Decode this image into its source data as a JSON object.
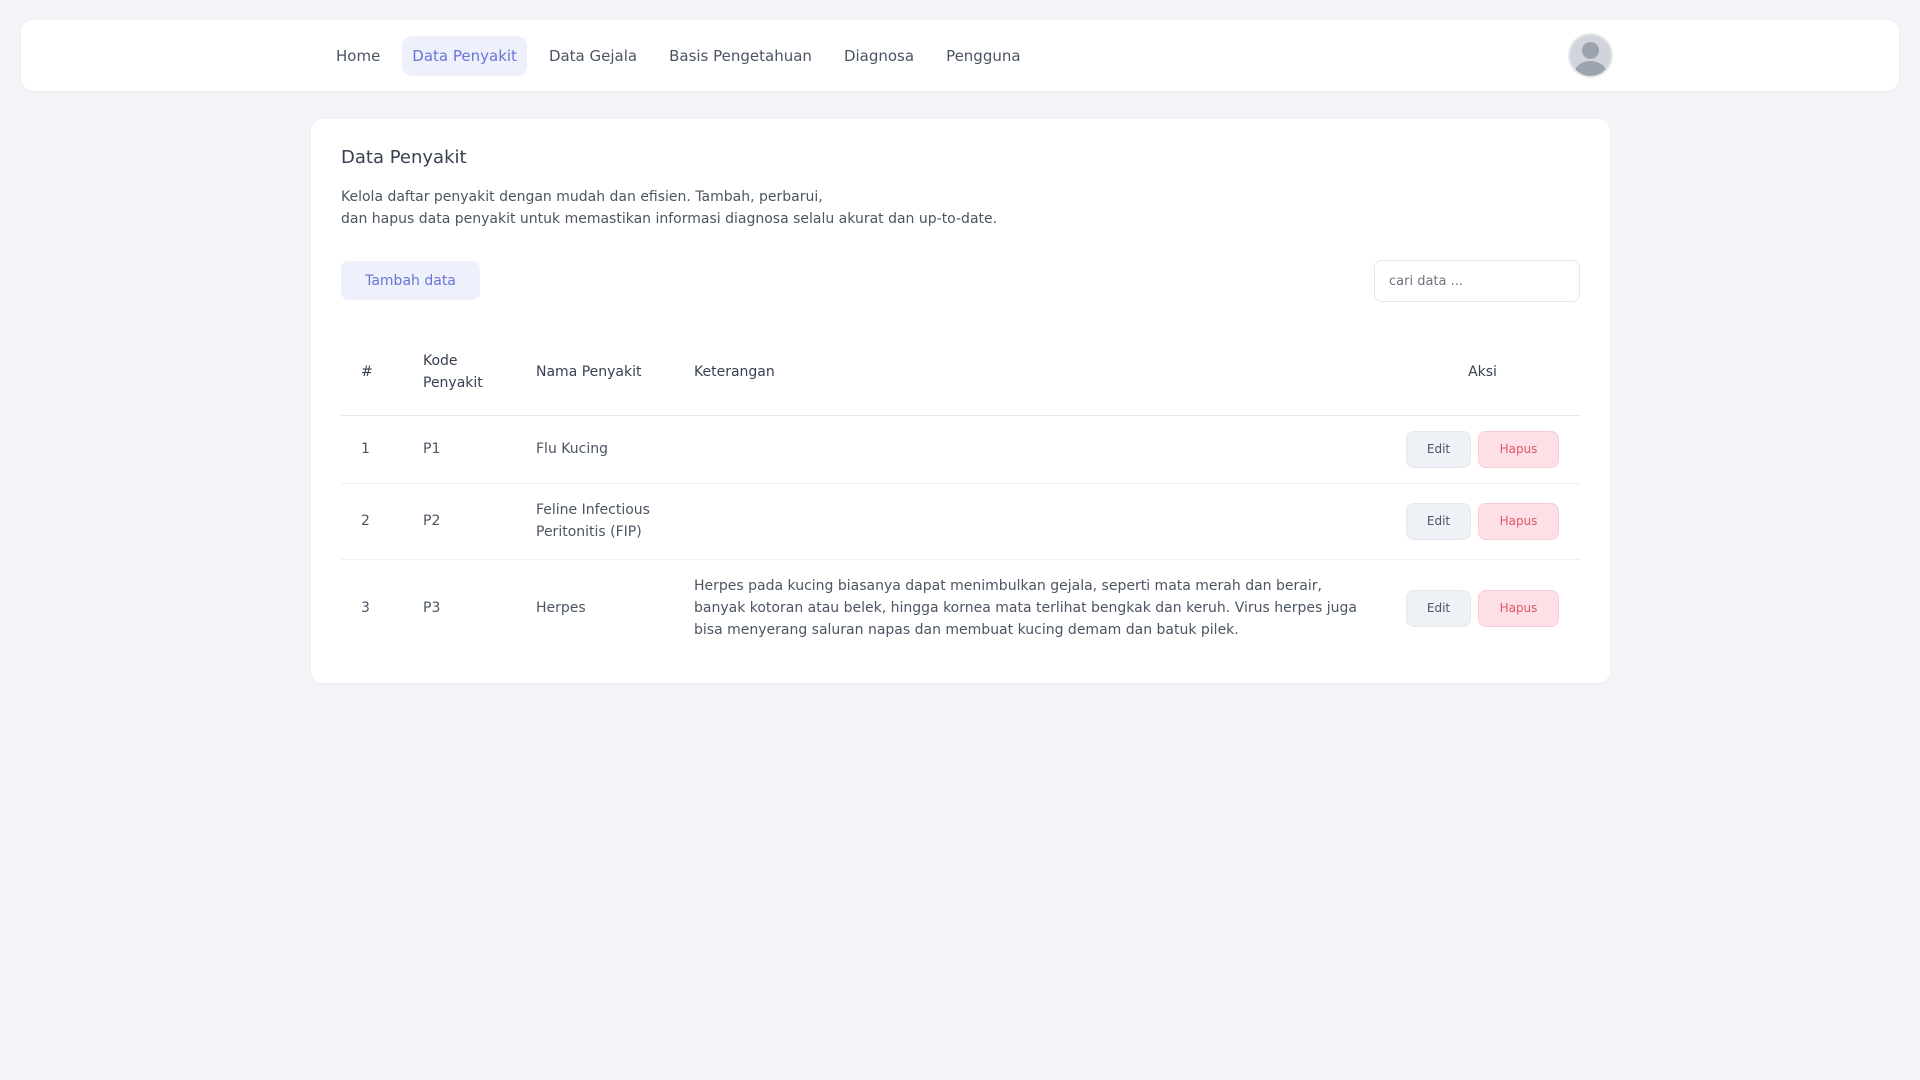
{
  "nav": {
    "items": [
      {
        "label": "Home"
      },
      {
        "label": "Data Penyakit",
        "active": true
      },
      {
        "label": "Data Gejala"
      },
      {
        "label": "Basis Pengetahuan"
      },
      {
        "label": "Diagnosa"
      },
      {
        "label": "Pengguna"
      }
    ],
    "avatar_icon": "user-avatar-icon"
  },
  "page": {
    "title": "Data Penyakit",
    "desc_line1": "Kelola daftar penyakit dengan mudah dan efisien. Tambah, perbarui,",
    "desc_line2": "dan hapus data penyakit untuk memastikan informasi diagnosa selalu akurat dan up-to-date.",
    "add_button": "Tambah data",
    "search_placeholder": "cari data ..."
  },
  "table": {
    "headers": {
      "num": "#",
      "kode_line1": "Kode",
      "kode_line2": "Penyakit",
      "nama": "Nama Penyakit",
      "keterangan": "Keterangan",
      "aksi": "Aksi"
    },
    "rows": [
      {
        "num": "1",
        "kode": "P1",
        "nama": "Flu Kucing",
        "keterangan": ""
      },
      {
        "num": "2",
        "kode": "P2",
        "nama": "Feline Infectious Peritonitis (FIP)",
        "keterangan": ""
      },
      {
        "num": "3",
        "kode": "P3",
        "nama": "Herpes",
        "keterangan": "Herpes pada kucing biasanya dapat menimbulkan gejala, seperti mata merah dan berair, banyak kotoran atau belek, hingga kornea mata terlihat bengkak dan keruh. Virus herpes juga bisa menyerang saluran napas dan membuat kucing demam dan batuk pilek."
      }
    ],
    "edit_label": "Edit",
    "hapus_label": "Hapus"
  },
  "colors": {
    "accent": "#6b74d6",
    "accent_bg": "#eef0fb",
    "danger": "#e0566b",
    "danger_bg": "#fde0e5",
    "page_bg": "#f3f4f7"
  }
}
